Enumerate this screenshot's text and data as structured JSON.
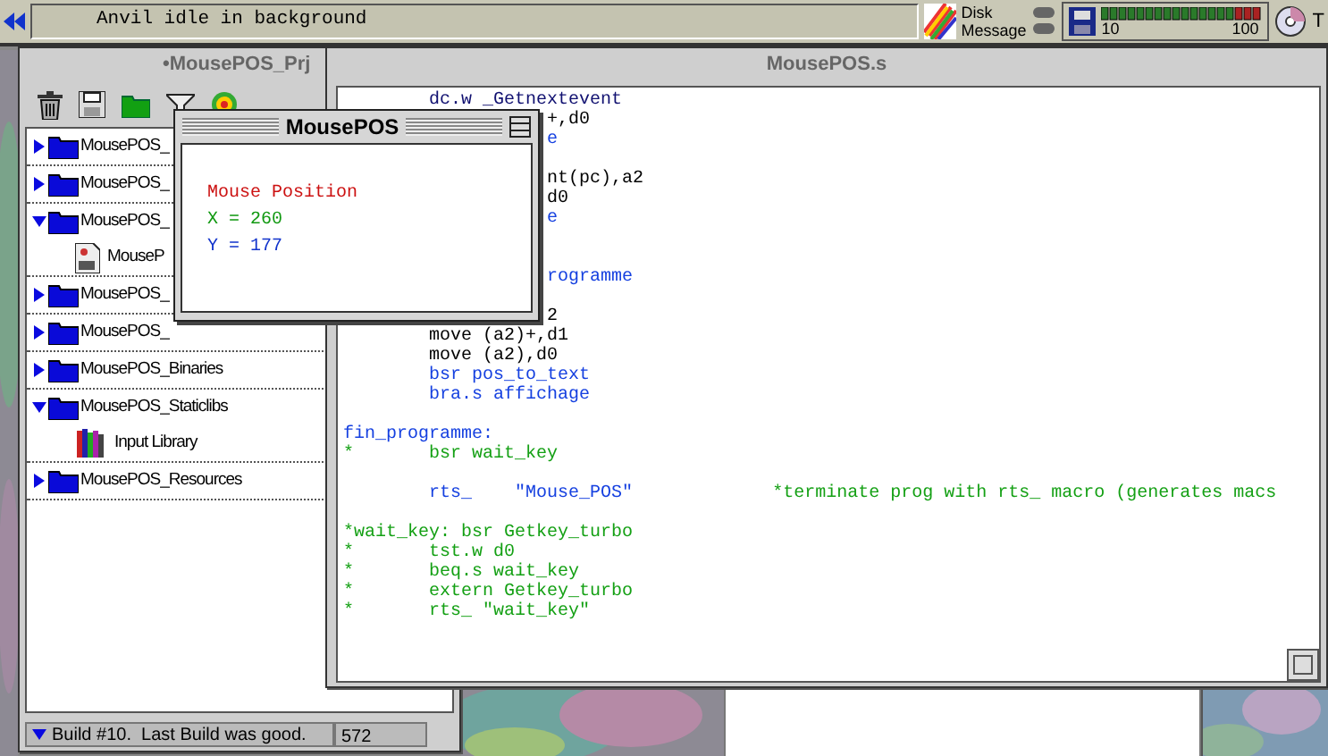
{
  "top_bar": {
    "message": "Anvil idle in background",
    "disk_label": "Disk",
    "message_label": "Message",
    "meter_labels": [
      "10",
      "100"
    ],
    "cut_label": "T"
  },
  "project_window": {
    "title": "•MousePOS_Prj",
    "items": [
      {
        "label": "MousePOS_",
        "kind": "folder",
        "expanded": false
      },
      {
        "label": "MousePOS_",
        "kind": "folder",
        "expanded": false
      },
      {
        "label": "MousePOS_",
        "kind": "folder",
        "expanded": true,
        "children": [
          {
            "label": "MouseP",
            "kind": "file"
          }
        ]
      },
      {
        "label": "MousePOS_",
        "kind": "folder",
        "expanded": false
      },
      {
        "label": "MousePOS_",
        "kind": "folder",
        "expanded": false
      },
      {
        "label": "MousePOS_Binaries",
        "kind": "folder",
        "expanded": false
      },
      {
        "label": "MousePOS_Staticlibs",
        "kind": "folder",
        "expanded": true,
        "children": [
          {
            "label": "Input Library",
            "kind": "library"
          }
        ]
      },
      {
        "label": "MousePOS_Resources",
        "kind": "folder",
        "expanded": false
      }
    ],
    "status": "Build #10.  Last Build was good.",
    "status_count": "572"
  },
  "source_window": {
    "title": "MousePOS.s",
    "lines": [
      {
        "kind": "code",
        "segments": [
          {
            "text": "        dc.w _Getnextevent",
            "kind": "directive"
          }
        ]
      },
      {
        "kind": "code",
        "segments": [
          {
            "text": "                   +,d0",
            "kind": "instruction"
          }
        ]
      },
      {
        "kind": "code",
        "segments": [
          {
            "text": "                   e",
            "kind": "branch"
          }
        ]
      },
      {
        "kind": "blank"
      },
      {
        "kind": "code",
        "segments": [
          {
            "text": "                   nt(pc),a2",
            "kind": "instruction"
          }
        ]
      },
      {
        "kind": "code",
        "segments": [
          {
            "text": "                   d0",
            "kind": "instruction"
          }
        ]
      },
      {
        "kind": "code",
        "segments": [
          {
            "text": "                   e",
            "kind": "branch"
          }
        ]
      },
      {
        "kind": "blank"
      },
      {
        "kind": "blank"
      },
      {
        "kind": "code",
        "segments": [
          {
            "text": "                   rogramme",
            "kind": "branch"
          }
        ]
      },
      {
        "kind": "blank"
      },
      {
        "kind": "code",
        "segments": [
          {
            "text": "                   2",
            "kind": "instruction"
          }
        ]
      },
      {
        "kind": "code",
        "segments": [
          {
            "text": "        move (a2)+,d1",
            "kind": "instruction"
          }
        ]
      },
      {
        "kind": "code",
        "segments": [
          {
            "text": "        move (a2),d0",
            "kind": "instruction"
          }
        ]
      },
      {
        "kind": "code",
        "segments": [
          {
            "text": "        bsr pos_to_text",
            "kind": "branch"
          }
        ]
      },
      {
        "kind": "code",
        "segments": [
          {
            "text": "        bra.s affichage",
            "kind": "branch"
          }
        ]
      },
      {
        "kind": "blank"
      },
      {
        "kind": "code",
        "segments": [
          {
            "text": "fin_programme:",
            "kind": "branch"
          }
        ]
      },
      {
        "kind": "code",
        "segments": [
          {
            "text": "*       bsr wait_key",
            "kind": "comment"
          }
        ]
      },
      {
        "kind": "blank"
      },
      {
        "kind": "code",
        "segments": [
          {
            "text": "        rts_    \"Mouse_POS\"",
            "kind": "branch"
          },
          {
            "text": "             *terminate prog with rts_ macro (generates macs",
            "kind": "comment"
          }
        ]
      },
      {
        "kind": "blank"
      },
      {
        "kind": "code",
        "segments": [
          {
            "text": "*wait_key: bsr Getkey_turbo",
            "kind": "comment"
          }
        ]
      },
      {
        "kind": "code",
        "segments": [
          {
            "text": "*       tst.w d0",
            "kind": "comment"
          }
        ]
      },
      {
        "kind": "code",
        "segments": [
          {
            "text": "*       beq.s wait_key",
            "kind": "comment"
          }
        ]
      },
      {
        "kind": "code",
        "segments": [
          {
            "text": "*       extern Getkey_turbo",
            "kind": "comment"
          }
        ]
      },
      {
        "kind": "code",
        "segments": [
          {
            "text": "*       rts_ \"wait_key\"",
            "kind": "comment"
          }
        ]
      }
    ]
  },
  "output_window": {
    "title": "MousePOS",
    "lines": [
      {
        "text": "Mouse Position",
        "color": "#cc1111"
      },
      {
        "text": "X = 260",
        "color": "#119911"
      },
      {
        "text": "Y = 177",
        "color": "#1133cc"
      }
    ]
  }
}
